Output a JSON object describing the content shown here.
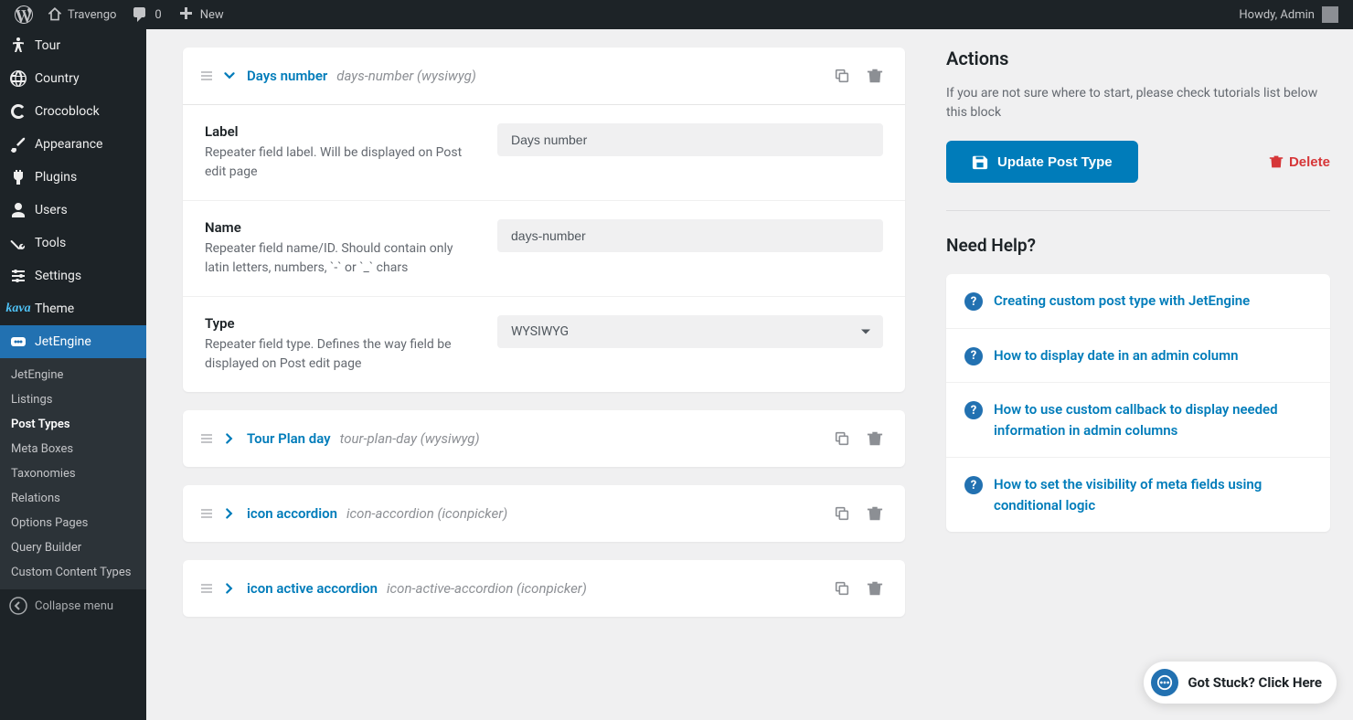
{
  "adminBar": {
    "siteName": "Travengo",
    "commentCount": "0",
    "newLabel": "New",
    "howdy": "Howdy, Admin"
  },
  "sidebar": {
    "tour": "Tour",
    "country": "Country",
    "crocoblock": "Crocoblock",
    "appearance": "Appearance",
    "plugins": "Plugins",
    "users": "Users",
    "tools": "Tools",
    "settings": "Settings",
    "theme": "Theme",
    "jetengine": "JetEngine",
    "collapse": "Collapse menu"
  },
  "submenu": {
    "jetengine": "JetEngine",
    "listings": "Listings",
    "postTypes": "Post Types",
    "metaBoxes": "Meta Boxes",
    "taxonomies": "Taxonomies",
    "relations": "Relations",
    "optionsPages": "Options Pages",
    "queryBuilder": "Query Builder",
    "customContent": "Custom Content Types"
  },
  "fields": [
    {
      "title": "Days number",
      "meta": "days-number (wysiwyg)",
      "expanded": true,
      "rows": {
        "label": {
          "title": "Label",
          "desc": "Repeater field label. Will be displayed on Post edit page",
          "value": "Days number"
        },
        "name": {
          "title": "Name",
          "desc": "Repeater field name/ID. Should contain only latin letters, numbers, `-` or `_` chars",
          "value": "days-number"
        },
        "type": {
          "title": "Type",
          "desc": "Repeater field type. Defines the way field be displayed on Post edit page",
          "value": "WYSIWYG"
        }
      }
    },
    {
      "title": "Tour Plan day",
      "meta": "tour-plan-day (wysiwyg)",
      "expanded": false
    },
    {
      "title": "icon accordion",
      "meta": "icon-accordion (iconpicker)",
      "expanded": false
    },
    {
      "title": "icon active accordion",
      "meta": "icon-active-accordion (iconpicker)",
      "expanded": false
    }
  ],
  "actions": {
    "title": "Actions",
    "desc": "If you are not sure where to start, please check tutorials list below this block",
    "updateLabel": "Update Post Type",
    "deleteLabel": "Delete"
  },
  "help": {
    "title": "Need Help?",
    "items": [
      "Creating custom post type with JetEngine",
      "How to display date in an admin column",
      "How to use custom callback to display needed information in admin columns",
      "How to set the visibility of meta fields using conditional logic"
    ]
  },
  "stuck": "Got Stuck? Click Here"
}
